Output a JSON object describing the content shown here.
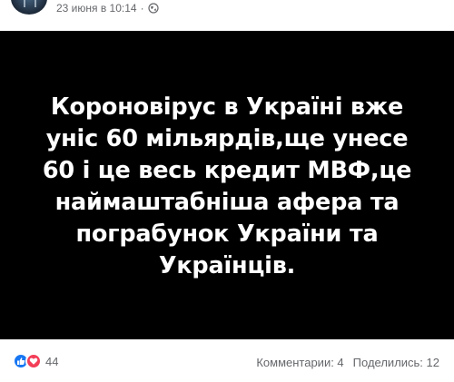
{
  "post": {
    "timestamp": "23 июня в 10:14",
    "separator": "·",
    "privacy_icon": "globe-icon",
    "image_text_lines": [
      "Короновірус в Україні вже",
      "уніс 60 мільярдів,ще унесе",
      "60 і це весь кредит МВФ,це",
      "наймаштабніша афера та",
      "пограбунок України та",
      "Українців."
    ]
  },
  "footer": {
    "reaction_icons": [
      "like-icon",
      "love-icon"
    ],
    "reaction_count": "44",
    "comments": "Комментарии: 4",
    "shares": "Поделились: 12"
  },
  "colors": {
    "background": "#ffffff",
    "image_background": "#000000",
    "image_text": "#ffffff",
    "meta_text": "#65676b",
    "like": "#1877f2",
    "love": "#f33e58"
  }
}
